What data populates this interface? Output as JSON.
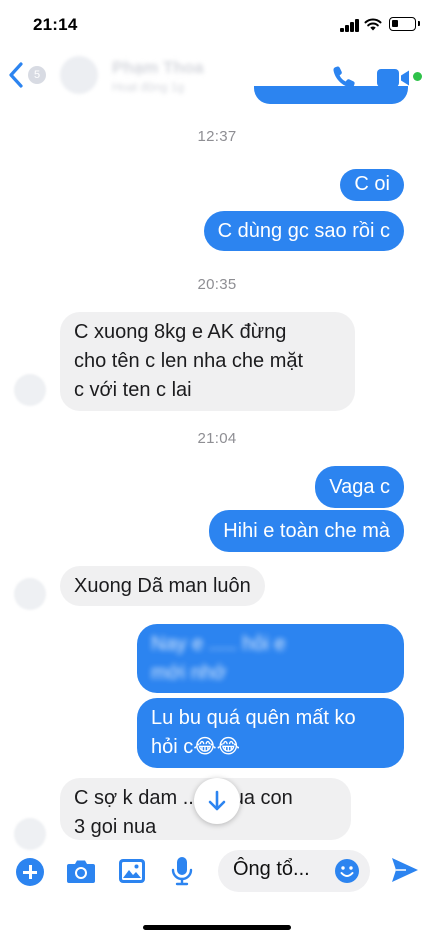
{
  "status_bar": {
    "time": "21:14"
  },
  "header": {
    "unread_count": "5",
    "contact_name": "Phạm Thoa",
    "contact_status": "Hoạt động 1g"
  },
  "messages": [
    {
      "type": "timestamp",
      "text": "12:37"
    },
    {
      "type": "outgoing",
      "text": "C oi"
    },
    {
      "type": "outgoing",
      "text": "C dùng gc sao rồi c"
    },
    {
      "type": "timestamp",
      "text": "20:35"
    },
    {
      "type": "incoming",
      "lines": [
        "C xuong 8kg e AK đừng",
        "cho tên c len nha che mặt",
        "c với ten c lai"
      ]
    },
    {
      "type": "timestamp",
      "text": "21:04"
    },
    {
      "type": "outgoing",
      "text": "Vaga c"
    },
    {
      "type": "outgoing",
      "text": "Hihi e toàn che mà"
    },
    {
      "type": "incoming",
      "text": "Xuong Dã man luôn"
    },
    {
      "type": "outgoing",
      "lines": [
        "Nay e ..... hỏi e",
        "mới nhớ"
      ],
      "obscured": true
    },
    {
      "type": "outgoing",
      "lines": [
        "Lu bu quá quên mất ko",
        "hỏi c😂😂"
      ]
    },
    {
      "type": "incoming",
      "lines": [
        "C sợ k dam ...... nua con",
        "3 goi nua"
      ]
    }
  ],
  "composer": {
    "input_value": "Ông tổ..."
  },
  "colors": {
    "accent": "#2c84f0",
    "incoming_bubble": "#f0f0f1",
    "active_status": "#2fc24a"
  },
  "icons": [
    "chevron-left-icon",
    "phone-icon",
    "video-camera-icon",
    "arrow-down-icon",
    "plus-icon",
    "camera-icon",
    "image-icon",
    "microphone-icon",
    "smiley-icon",
    "send-icon"
  ]
}
